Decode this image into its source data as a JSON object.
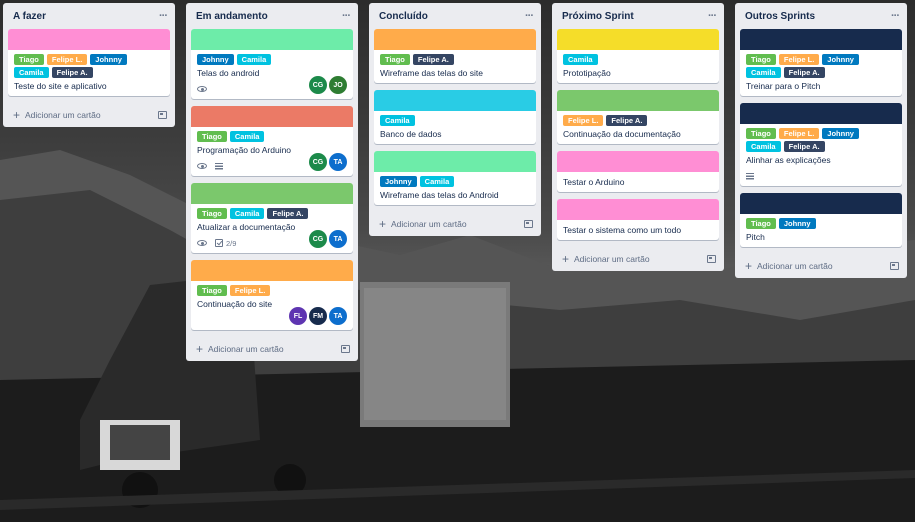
{
  "colors": {
    "green": "#61bd4f",
    "orange": "#ffab4a",
    "blue": "#0079bf",
    "sky": "#00c2e0",
    "dark": "#344563",
    "pink": "#ff8ed4",
    "mint": "#6deca9",
    "red": "#eb7a66",
    "lime": "#7bc86c",
    "yellow": "#f5dd29",
    "cyan": "#29cce5",
    "navy": "#172b4d"
  },
  "labels": {
    "tiago": "Tiago",
    "felipe": "Felipe L.",
    "johnny": "Johnny",
    "camila": "Camila",
    "felipe_a": "Felipe A."
  },
  "icons": {
    "list_menu": "more-horizontal-icon",
    "add": "plus-icon",
    "template": "card-template-icon",
    "watch": "eye-icon",
    "description": "description-icon",
    "checklist": "checklist-icon"
  },
  "add_card_label": "Adicionar um cartão",
  "lists": [
    {
      "title": "A fazer",
      "cards": [
        {
          "cover": "pink",
          "labels": [
            "tiago",
            "felipe",
            "johnny",
            "camila",
            "felipe_a"
          ],
          "title": "Teste do site e aplicativo"
        }
      ]
    },
    {
      "title": "Em andamento",
      "cards": [
        {
          "cover": "mint",
          "labels": [
            "johnny",
            "camila"
          ],
          "title": "Telas do android",
          "watch": true,
          "members": [
            "CG",
            "JO"
          ]
        },
        {
          "cover": "red",
          "labels": [
            "tiago",
            "camila"
          ],
          "title": "Programação do Arduino",
          "watch": true,
          "description": true,
          "members": [
            "CG",
            "TA"
          ]
        },
        {
          "cover": "lime",
          "labels": [
            "tiago",
            "camila",
            "felipe_a"
          ],
          "title": "Atualizar a documentação",
          "watch": true,
          "checklist": "2/9",
          "members": [
            "CG",
            "TA"
          ]
        },
        {
          "cover": "orange",
          "labels": [
            "tiago",
            "felipe"
          ],
          "title": "Continuação do site",
          "members": [
            "FL",
            "FM",
            "TA"
          ]
        }
      ]
    },
    {
      "title": "Concluído",
      "cards": [
        {
          "cover": "orange",
          "labels": [
            "tiago",
            "felipe_a"
          ],
          "title": "Wireframe das telas do site"
        },
        {
          "cover": "cyan",
          "labels": [
            "camila"
          ],
          "title": "Banco de dados"
        },
        {
          "cover": "mint",
          "labels": [
            "johnny",
            "camila"
          ],
          "title": "Wireframe das telas do Android"
        }
      ]
    },
    {
      "title": "Próximo Sprint",
      "cards": [
        {
          "cover": "yellow",
          "labels": [
            "camila"
          ],
          "title": "Prototipação"
        },
        {
          "cover": "lime",
          "labels": [
            "felipe",
            "felipe_a"
          ],
          "title": "Continuação da documentação"
        },
        {
          "cover": "pink",
          "labels": [],
          "title": "Testar o Arduino"
        },
        {
          "cover": "pink",
          "labels": [],
          "title": "Testar o sistema como um todo"
        }
      ]
    },
    {
      "title": "Outros Sprints",
      "cards": [
        {
          "cover": "navy",
          "labels": [
            "tiago",
            "felipe",
            "johnny",
            "camila",
            "felipe_a"
          ],
          "title": "Treinar para o Pitch"
        },
        {
          "cover": "navy",
          "labels": [
            "tiago",
            "felipe",
            "johnny",
            "camila",
            "felipe_a"
          ],
          "title": "Alinhar as explicações",
          "description": true
        },
        {
          "cover": "navy",
          "labels": [
            "tiago",
            "johnny"
          ],
          "title": "Pitch"
        }
      ]
    }
  ],
  "avatars": {
    "CG": "#1c8a4a",
    "JO": "#2e7d32",
    "TA": "#0d6ecd",
    "FL": "#5e35b1",
    "FM": "#172b4d"
  }
}
